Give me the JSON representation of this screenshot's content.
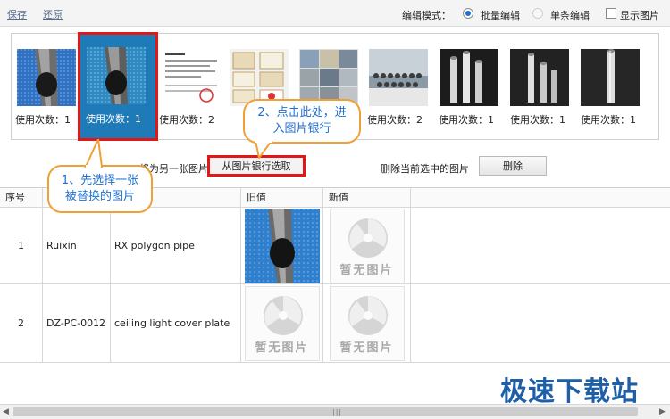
{
  "toolbar": {
    "save_label": "保存",
    "restore_label": "还原",
    "mode_label": "编辑模式：",
    "batch_label": "批量编辑",
    "single_label": "单条编辑",
    "show_image_label": "显示图片"
  },
  "strip": {
    "usage_labels": [
      "使用次数：1",
      "使用次数：1",
      "使用次数：2",
      "",
      "",
      "使用次数：2",
      "使用次数：1",
      "使用次数：1",
      "使用次数：1"
    ]
  },
  "actions": {
    "replace_text": "将为另一张图片",
    "bank_select_label": "从图片银行选取",
    "delete_text": "删除当前选中的图片",
    "delete_label": "删除"
  },
  "table": {
    "headers": [
      "序号",
      "",
      "",
      "旧值",
      "新值"
    ],
    "rows": [
      {
        "index": "1",
        "code": "Ruixin",
        "name": "RX polygon pipe"
      },
      {
        "index": "2",
        "code": "DZ-PC-0012",
        "name": "ceiling light cover plate"
      }
    ],
    "no_image_text": "暂无图片"
  },
  "callouts": {
    "step1": "1、先选择一张\n被替换的图片",
    "step2": "2、点击此处，进\n入图片银行"
  },
  "watermark": "极速下载站",
  "colors": {
    "accent": "#1f7ab8",
    "highlight_red": "#e01818",
    "callout_border": "#f0a037",
    "callout_text": "#1f6fd1",
    "watermark": "#1e5fa8"
  }
}
